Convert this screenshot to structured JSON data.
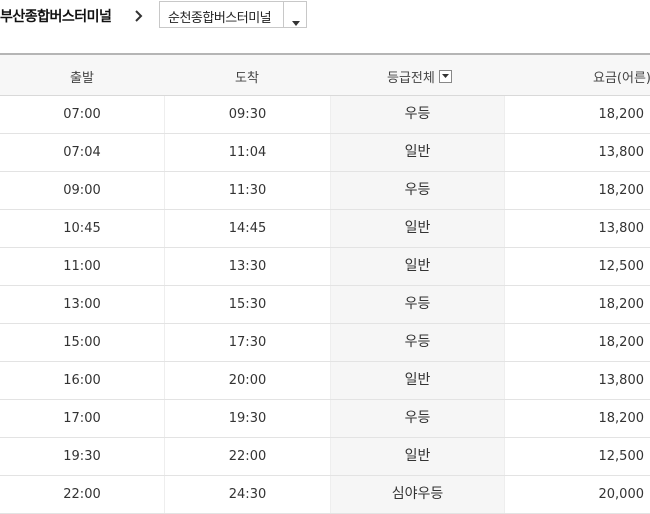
{
  "route": {
    "origin": "부산종합버스터미널",
    "destination": "순천종합버스터미널"
  },
  "table": {
    "headers": {
      "depart": "출발",
      "arrive": "도착",
      "grade": "등급전체",
      "fare": "요금(어른)"
    },
    "rows": [
      {
        "depart": "07:00",
        "arrive": "09:30",
        "grade": "우등",
        "fare": "18,200"
      },
      {
        "depart": "07:04",
        "arrive": "11:04",
        "grade": "일반",
        "fare": "13,800"
      },
      {
        "depart": "09:00",
        "arrive": "11:30",
        "grade": "우등",
        "fare": "18,200"
      },
      {
        "depart": "10:45",
        "arrive": "14:45",
        "grade": "일반",
        "fare": "13,800"
      },
      {
        "depart": "11:00",
        "arrive": "13:30",
        "grade": "일반",
        "fare": "12,500"
      },
      {
        "depart": "13:00",
        "arrive": "15:30",
        "grade": "우등",
        "fare": "18,200"
      },
      {
        "depart": "15:00",
        "arrive": "17:30",
        "grade": "우등",
        "fare": "18,200"
      },
      {
        "depart": "16:00",
        "arrive": "20:00",
        "grade": "일반",
        "fare": "13,800"
      },
      {
        "depart": "17:00",
        "arrive": "19:30",
        "grade": "우등",
        "fare": "18,200"
      },
      {
        "depart": "19:30",
        "arrive": "22:00",
        "grade": "일반",
        "fare": "12,500"
      },
      {
        "depart": "22:00",
        "arrive": "24:30",
        "grade": "심야우등",
        "fare": "20,000"
      }
    ]
  },
  "icons": {
    "route_arrow": "chevron-right-icon",
    "dest_caret": "caret-down-icon",
    "grade_filter": "caret-down-icon"
  }
}
